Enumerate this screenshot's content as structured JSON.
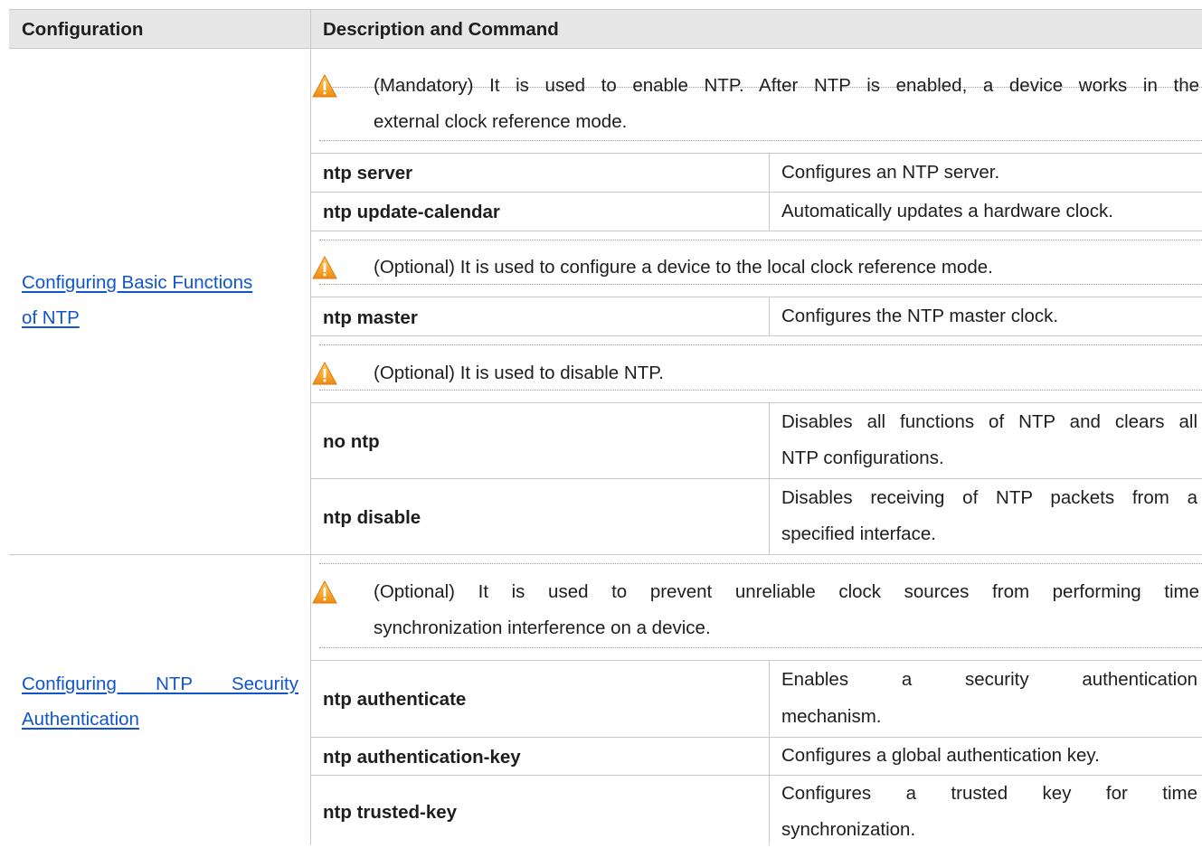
{
  "table": {
    "headers": [
      "Configuration",
      "Description and Command"
    ],
    "groups": [
      {
        "config_link": "Configuring Basic Functions of NTP",
        "config_link_lines": [
          "Configuring Basic Functions",
          "of NTP"
        ],
        "blocks": [
          {
            "note": "(Mandatory) It is used to enable NTP. After NTP is enabled, a device works in the external clock reference mode.",
            "note_lines": [
              "(Mandatory) It is used to enable NTP. After NTP is enabled, a device works in the",
              "external clock reference mode."
            ],
            "rows": [
              {
                "command": "ntp server",
                "description": "Configures an NTP server."
              },
              {
                "command": "ntp update-calendar",
                "description": "Automatically updates a hardware clock."
              }
            ]
          },
          {
            "note": "(Optional) It is used to configure a device to the local clock reference mode.",
            "rows": [
              {
                "command": "ntp master",
                "description": "Configures the NTP master clock."
              }
            ]
          },
          {
            "note": "(Optional) It is used to disable NTP.",
            "rows": [
              {
                "command": "no ntp",
                "description_lines": [
                  "Disables all functions of NTP and clears all",
                  "NTP configurations."
                ]
              },
              {
                "command": "ntp disable",
                "description_lines": [
                  "Disables receiving of NTP packets from a",
                  "specified interface."
                ]
              }
            ]
          }
        ]
      },
      {
        "config_link": "Configuring NTP Security Authentication",
        "config_link_lines": [
          "Configuring NTP Security",
          "Authentication"
        ],
        "blocks": [
          {
            "note_lines": [
              "(Optional) It is used to prevent unreliable clock sources from performing time",
              "synchronization interference on a device."
            ],
            "rows": [
              {
                "command": "ntp authenticate",
                "description_lines": [
                  "Enables a security authentication",
                  "mechanism."
                ]
              },
              {
                "command": "ntp authentication-key",
                "description": "Configures a global authentication key."
              },
              {
                "command": "ntp trusted-key",
                "description_lines": [
                  "Configures a trusted key for time",
                  "synchronization."
                ]
              }
            ]
          }
        ]
      }
    ]
  },
  "icons": {
    "warning": "warning-triangle-icon"
  },
  "colors": {
    "header_bg": "#e6e6e6",
    "link": "#1155cc",
    "warning_orange": "#f39a1e"
  }
}
